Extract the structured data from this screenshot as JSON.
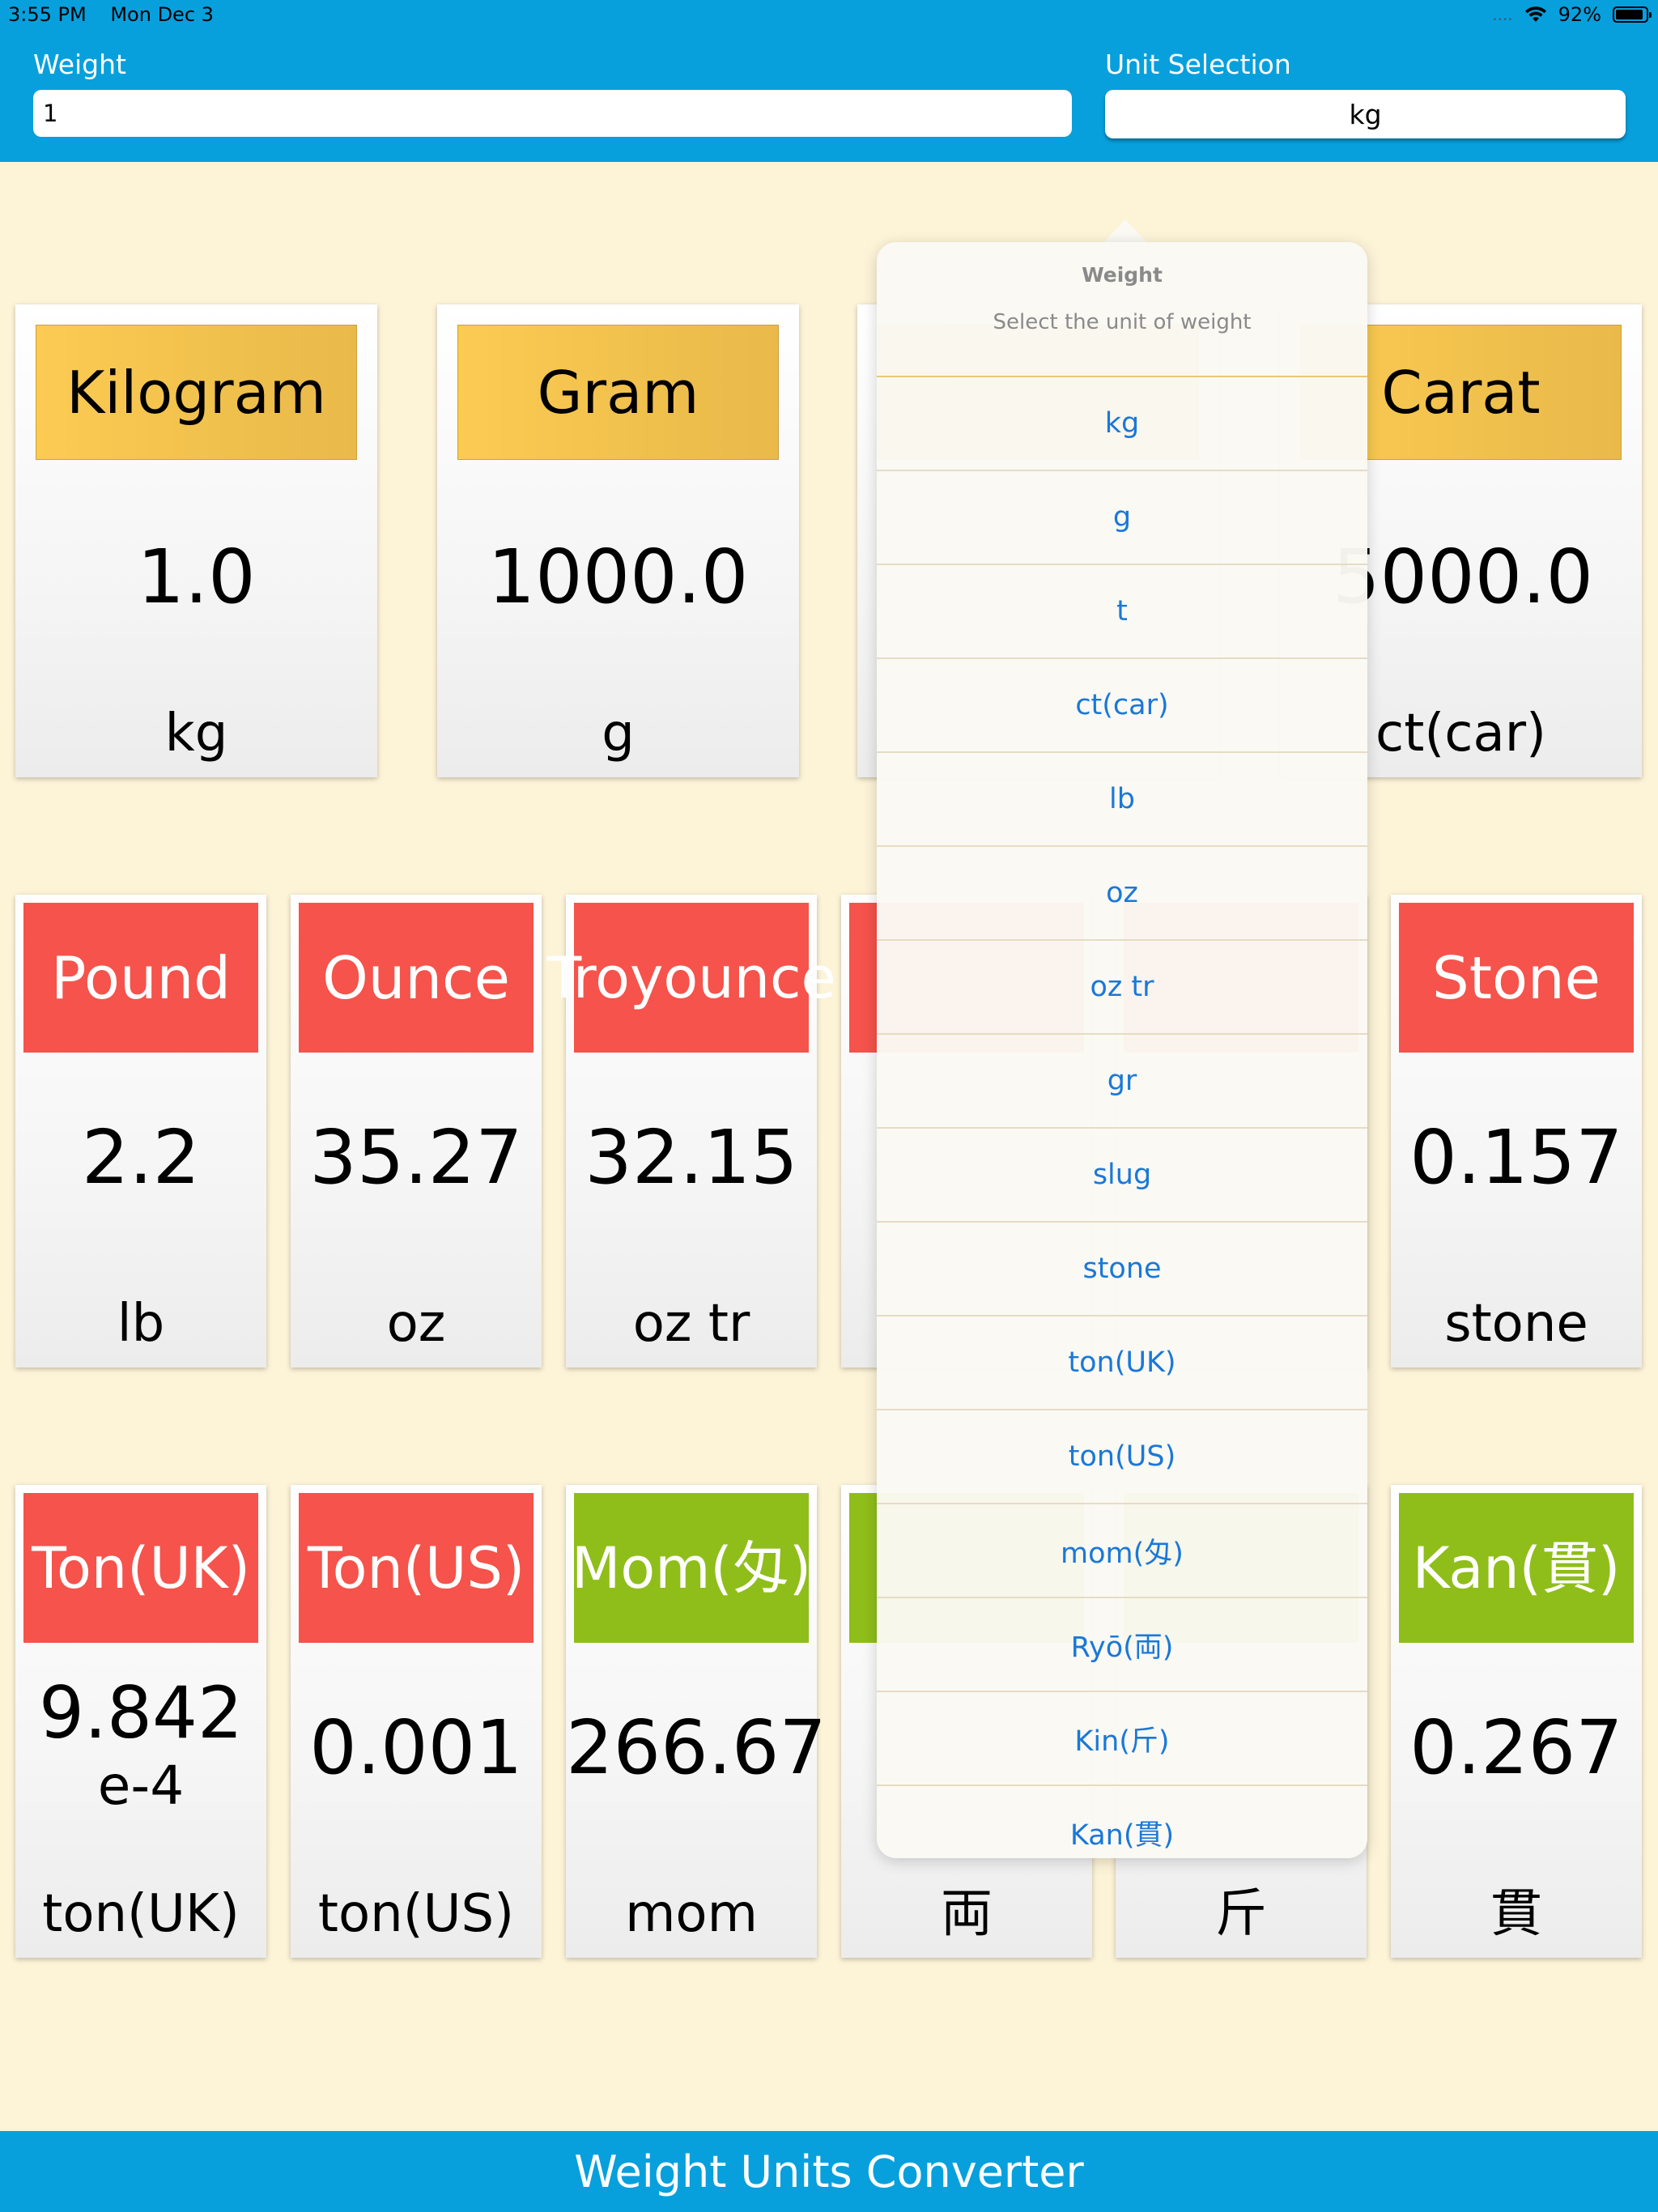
{
  "status": {
    "time": "3:55 PM",
    "date": "Mon Dec 3",
    "battery": "92%",
    "signal": "....",
    "battery_level": 0.92
  },
  "inputs": {
    "weight_label": "Weight",
    "weight_value": "1",
    "unit_label": "Unit Selection",
    "unit_value": "kg"
  },
  "colors": {
    "header": "#07a0dd",
    "background": "#fdf4d8",
    "gold": "#f8c84e",
    "red": "#f5534b",
    "green": "#8fbe1a",
    "link": "#1a78d8"
  },
  "cards": [
    {
      "title": "Kilogram",
      "value": "1.0",
      "unit": "kg",
      "theme": "gold"
    },
    {
      "title": "Gram",
      "value": "1000.0",
      "unit": "g",
      "theme": "gold"
    },
    {
      "title": "Carat",
      "value": "5000.0",
      "unit": "ct(car)",
      "theme": "gold"
    },
    {
      "title": "Pound",
      "value": "2.2",
      "unit": "lb",
      "theme": "red"
    },
    {
      "title": "Ounce",
      "value": "35.27",
      "unit": "oz",
      "theme": "red"
    },
    {
      "title": "Troy\nounce",
      "value": "32.15",
      "unit": "oz tr",
      "theme": "red"
    },
    {
      "title": "Stone",
      "value": "0.157",
      "unit": "stone",
      "theme": "red"
    },
    {
      "title": "Ton\n(UK)",
      "value": "9.842",
      "value_exp": "e-4",
      "unit": "ton(UK)",
      "theme": "red"
    },
    {
      "title": "Ton\n(US)",
      "value": "0.001",
      "unit": "ton(US)",
      "theme": "red"
    },
    {
      "title": "Mom\n(匁)",
      "value": "266.67",
      "unit": "mom",
      "theme": "green"
    },
    {
      "title": "",
      "value": "",
      "unit": "両",
      "theme": "green"
    },
    {
      "title": "",
      "value": "",
      "unit": "斤",
      "theme": "green"
    },
    {
      "title": "Kan\n(貫)",
      "value": "0.267",
      "unit": "貫",
      "theme": "green"
    }
  ],
  "popover": {
    "title": "Weight",
    "message": "Select the unit of weight",
    "options": [
      "kg",
      "g",
      "t",
      "ct(car)",
      "lb",
      "oz",
      "oz tr",
      "gr",
      "slug",
      "stone",
      "ton(UK)",
      "ton(US)",
      "mom(匁)",
      "Ryō(両)",
      "Kin(斤)",
      "Kan(貫)"
    ]
  },
  "footer": {
    "title": "Weight Units Converter"
  }
}
